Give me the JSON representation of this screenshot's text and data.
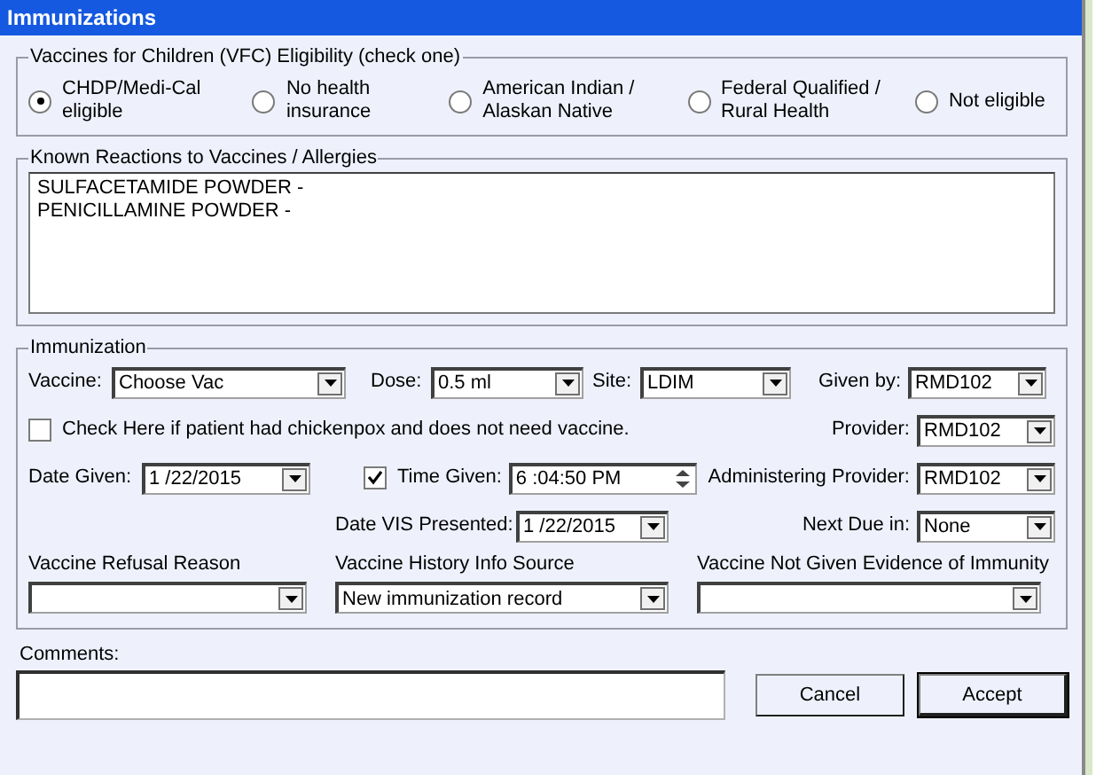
{
  "window": {
    "title": "Immunizations"
  },
  "vfc": {
    "legend": "Vaccines for Children (VFC) Eligibility (check one)",
    "options": [
      {
        "label": "CHDP/Medi-Cal eligible",
        "selected": true
      },
      {
        "label": "No health insurance",
        "selected": false
      },
      {
        "label": "American Indian / Alaskan Native",
        "selected": false
      },
      {
        "label": "Federal Qualified / Rural Health",
        "selected": false
      },
      {
        "label": "Not eligible",
        "selected": false
      }
    ]
  },
  "reactions": {
    "legend": "Known Reactions to Vaccines / Allergies",
    "lines": [
      "SULFACETAMIDE POWDER -",
      "PENICILLAMINE POWDER -"
    ]
  },
  "immunization": {
    "legend": "Immunization",
    "vaccine": {
      "label": "Vaccine:",
      "value": "Choose Vac"
    },
    "dose": {
      "label": "Dose:",
      "value": "0.5 ml"
    },
    "site": {
      "label": "Site:",
      "value": "LDIM"
    },
    "given_by": {
      "label": "Given by:",
      "value": "RMD102"
    },
    "chickenpox": {
      "label": "Check Here if patient had chickenpox and does not need vaccine.",
      "checked": false
    },
    "provider": {
      "label": "Provider:",
      "value": "RMD102"
    },
    "date_given": {
      "label": "Date Given:",
      "value": "1 /22/2015"
    },
    "time_given": {
      "label": "Time Given:",
      "checked": true,
      "value": "6 :04:50 PM"
    },
    "administering_provider": {
      "label": "Administering Provider:",
      "value": "RMD102"
    },
    "date_vis": {
      "label": "Date VIS Presented:",
      "value": "1 /22/2015"
    },
    "next_due": {
      "label": "Next Due in:",
      "value": "None"
    },
    "refusal_reason": {
      "label": "Vaccine Refusal Reason"
    },
    "history_source": {
      "label": "Vaccine History Info Source",
      "value": "New immunization record"
    },
    "evidence": {
      "label": "Vaccine Not Given Evidence of Immunity"
    }
  },
  "comments": {
    "label": "Comments:"
  },
  "buttons": [
    {
      "label": "Cancel",
      "default": false
    },
    {
      "label": "Accept",
      "default": true
    }
  ]
}
